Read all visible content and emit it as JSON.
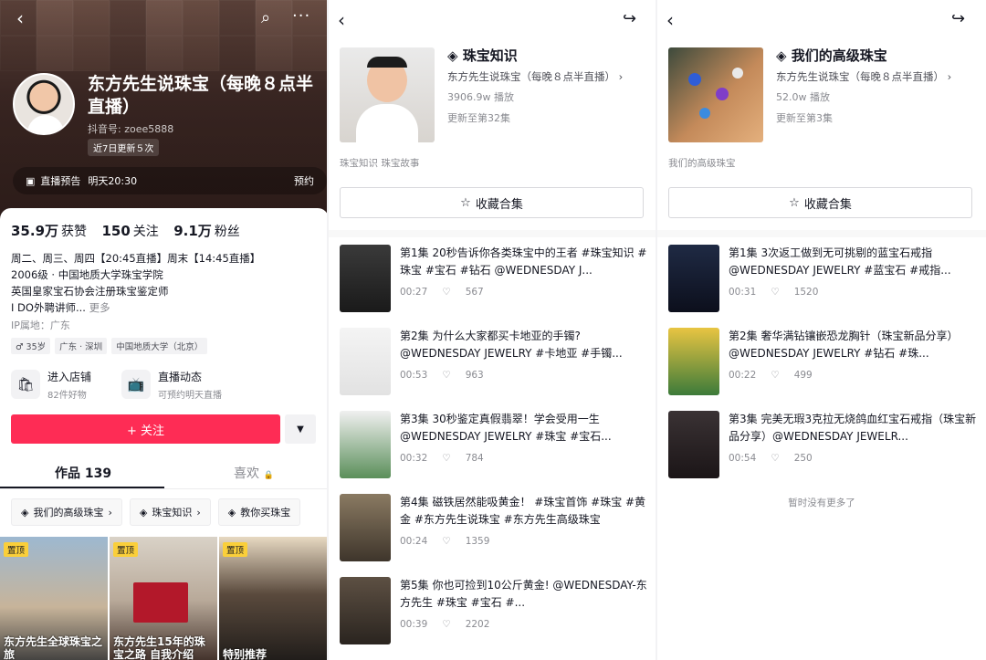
{
  "profile": {
    "name": "东方先生说珠宝（每晚８点半直播）",
    "douyin_id": "抖音号: zoee5888",
    "recent_updates": "近7日更新５次",
    "live_notice": {
      "label": "直播预告",
      "time": "明天20:30",
      "action": "预约"
    },
    "stats": [
      {
        "value": "35.9万",
        "label": "获赞"
      },
      {
        "value": "150",
        "label": "关注"
      },
      {
        "value": "9.1万",
        "label": "粉丝"
      }
    ],
    "bio": [
      "周二、周三、周四【20:45直播】周末【14:45直播】",
      "2006级 · 中国地质大学珠宝学院",
      "英国皇家宝石协会注册珠宝鉴定师",
      "I DO外聘讲师..."
    ],
    "bio_more": "更多",
    "ip_location": "IP属地：广东",
    "tags": [
      "♂ 35岁",
      "广东 · 深圳",
      "中国地质大学（北京）"
    ],
    "store": {
      "title": "进入店铺",
      "sub": "82件好物"
    },
    "live_feed": {
      "title": "直播动态",
      "sub": "可预约明天直播"
    },
    "follow_label": "+ 关注",
    "tabs": {
      "works": "作品 139",
      "likes": "喜欢"
    },
    "collections": [
      "我们的高级珠宝",
      "珠宝知识",
      "教你买珠宝"
    ],
    "pinned_label": "置顶",
    "thumb_captions": [
      "东方先生全球珠宝之旅",
      "东方先生15年的珠宝之路 自我介绍",
      "特别推荐"
    ]
  },
  "collection_knowledge": {
    "title": "珠宝知识",
    "author": "东方先生说珠宝（每晚８点半直播）",
    "plays": "3906.9w 播放",
    "update": "更新至第32集",
    "tags": "珠宝知识  珠宝故事",
    "save_label": "收藏合集",
    "episodes": [
      {
        "title": "第1集 20秒告诉你各类珠宝中的王者 #珠宝知识 #珠宝 #宝石 #钻石 @WEDNESDAY J...",
        "duration": "00:27",
        "likes": "567"
      },
      {
        "title": "第2集 为什么大家都买卡地亚的手镯? @WEDNESDAY JEWELRY #卡地亚 #手镯...",
        "duration": "00:53",
        "likes": "963"
      },
      {
        "title": "第3集 30秒鉴定真假翡翠！学会受用一生 @WEDNESDAY JEWELRY #珠宝 #宝石...",
        "duration": "00:32",
        "likes": "784"
      },
      {
        "title": "第4集 磁铁居然能吸黄金！ #珠宝首饰 #珠宝 #黄金 #东方先生说珠宝 #东方先生高级珠宝",
        "duration": "00:24",
        "likes": "1359"
      },
      {
        "title": "第5集 你也可捡到10公斤黄金! @WEDNESDAY-东方先生 #珠宝 #宝石 #...",
        "duration": "00:39",
        "likes": "2202"
      }
    ]
  },
  "collection_jewelry": {
    "title": "我们的高级珠宝",
    "author": "东方先生说珠宝（每晚８点半直播）",
    "plays": "52.0w 播放",
    "update": "更新至第3集",
    "tags": "我们的高级珠宝",
    "save_label": "收藏合集",
    "episodes": [
      {
        "title": "第1集 3次返工做到无可挑剔的蓝宝石戒指 @WEDNESDAY JEWELRY #蓝宝石 #戒指...",
        "duration": "00:31",
        "likes": "1520"
      },
      {
        "title": "第2集 奢华满钻镶嵌恐龙胸针（珠宝新品分享）@WEDNESDAY JEWELRY #钻石 #珠...",
        "duration": "00:22",
        "likes": "499"
      },
      {
        "title": "第3集 完美无瑕3克拉无烧鸽血红宝石戒指（珠宝新品分享）@WEDNESDAY JEWELR...",
        "duration": "00:54",
        "likes": "250"
      }
    ],
    "no_more": "暂时没有更多了"
  },
  "icons": {
    "back": "back-icon",
    "share": "share-icon",
    "search": "search-icon",
    "more": "more-icon",
    "stack": "stack-icon",
    "heart": "heart-icon",
    "star": "star-icon",
    "lock": "lock-icon"
  },
  "colors": {
    "accent": "#fe2c55",
    "pin": "#facf3a",
    "text": "#161823",
    "muted": "#8a8b91"
  }
}
